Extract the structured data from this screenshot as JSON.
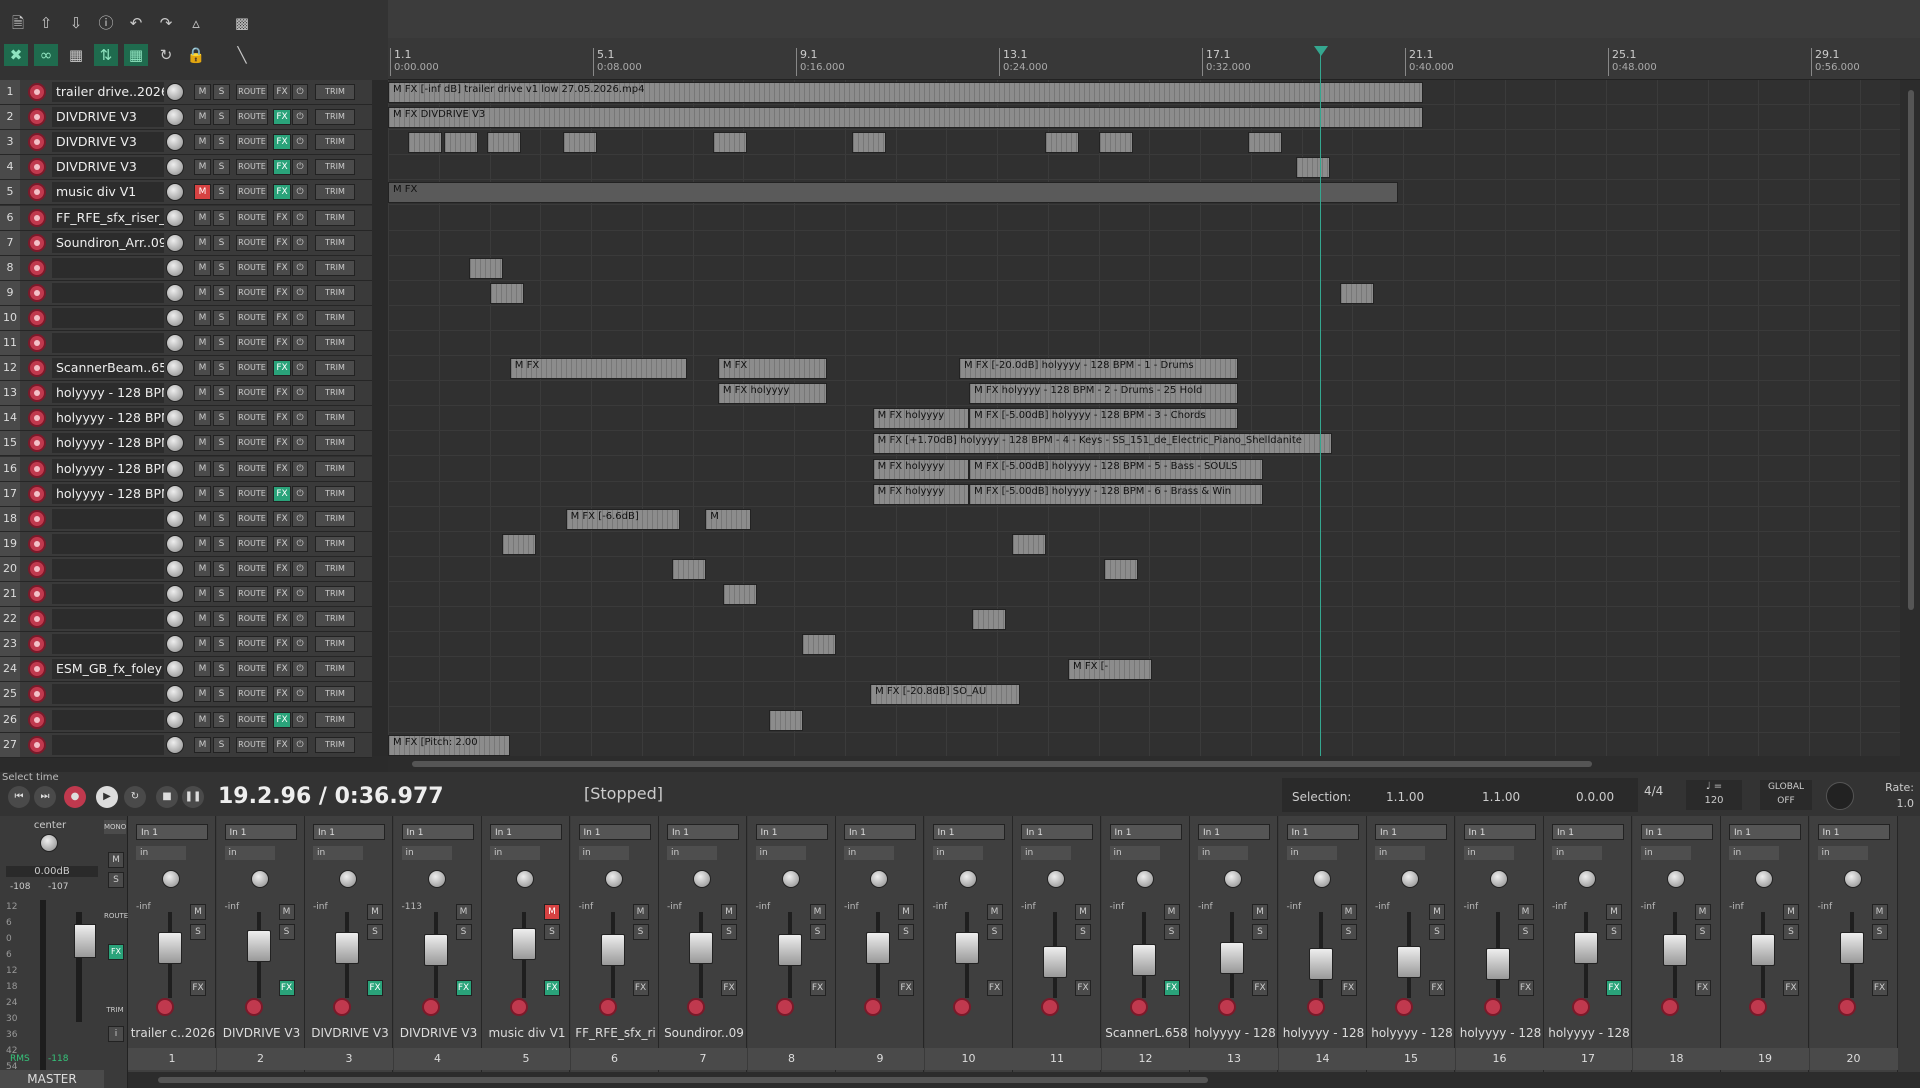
{
  "toolbar": {
    "row1": [
      "new-project",
      "open",
      "save",
      "info",
      "undo",
      "redo",
      "metronome",
      "grid-view"
    ],
    "row2": [
      "ripple",
      "link",
      "snap-grid",
      "move",
      "grid",
      "loop",
      "lock",
      "erase"
    ]
  },
  "ruler": {
    "markers": [
      {
        "bar": "1.1",
        "time": "0:00.000"
      },
      {
        "bar": "5.1",
        "time": "0:08.000"
      },
      {
        "bar": "9.1",
        "time": "0:16.000"
      },
      {
        "bar": "13.1",
        "time": "0:24.000"
      },
      {
        "bar": "17.1",
        "time": "0:32.000"
      },
      {
        "bar": "21.1",
        "time": "0:40.000"
      },
      {
        "bar": "25.1",
        "time": "0:48.000"
      },
      {
        "bar": "29.1",
        "time": "0:56.000"
      }
    ]
  },
  "tcp": {
    "mute": "M",
    "solo": "S",
    "route": "ROUTE",
    "fx": "FX",
    "trim": "TRIM",
    "tracks": [
      {
        "num": "1",
        "name": "trailer drive..2026",
        "fx_on": false,
        "muted": false
      },
      {
        "num": "2",
        "name": "DIVDRIVE V3",
        "fx_on": true,
        "muted": false
      },
      {
        "num": "3",
        "name": "DIVDRIVE V3",
        "fx_on": true,
        "muted": false
      },
      {
        "num": "4",
        "name": "DIVDRIVE V3",
        "fx_on": true,
        "muted": false
      },
      {
        "num": "5",
        "name": "music div  V1",
        "fx_on": true,
        "muted": true
      },
      {
        "num": "6",
        "name": "FF_RFE_sfx_riser_",
        "fx_on": false,
        "muted": false
      },
      {
        "num": "7",
        "name": "Soundiron_Arr..09",
        "fx_on": false,
        "muted": false
      },
      {
        "num": "8",
        "name": "",
        "fx_on": false,
        "muted": false
      },
      {
        "num": "9",
        "name": "",
        "fx_on": false,
        "muted": false
      },
      {
        "num": "10",
        "name": "",
        "fx_on": false,
        "muted": false
      },
      {
        "num": "11",
        "name": "",
        "fx_on": false,
        "muted": false
      },
      {
        "num": "12",
        "name": "ScannerBeam..658",
        "fx_on": true,
        "muted": false
      },
      {
        "num": "13",
        "name": "holyyyy - 128 BPM",
        "fx_on": false,
        "muted": false
      },
      {
        "num": "14",
        "name": "holyyyy - 128 BPM",
        "fx_on": false,
        "muted": false
      },
      {
        "num": "15",
        "name": "holyyyy - 128 BPM",
        "fx_on": false,
        "muted": false
      },
      {
        "num": "16",
        "name": "holyyyy - 128 BPM",
        "fx_on": false,
        "muted": false
      },
      {
        "num": "17",
        "name": "holyyyy - 128 BPM",
        "fx_on": true,
        "muted": false
      },
      {
        "num": "18",
        "name": "",
        "fx_on": false,
        "muted": false
      },
      {
        "num": "19",
        "name": "",
        "fx_on": false,
        "muted": false
      },
      {
        "num": "20",
        "name": "",
        "fx_on": false,
        "muted": false
      },
      {
        "num": "21",
        "name": "",
        "fx_on": false,
        "muted": false
      },
      {
        "num": "22",
        "name": "",
        "fx_on": false,
        "muted": false
      },
      {
        "num": "23",
        "name": "",
        "fx_on": false,
        "muted": false
      },
      {
        "num": "24",
        "name": "ESM_GB_fx_foley",
        "fx_on": false,
        "muted": false
      },
      {
        "num": "25",
        "name": "",
        "fx_on": false,
        "muted": false
      },
      {
        "num": "26",
        "name": "",
        "fx_on": true,
        "muted": false
      },
      {
        "num": "27",
        "name": "",
        "fx_on": false,
        "muted": false
      }
    ]
  },
  "items": [
    {
      "track": 1,
      "start_sec": 0.0,
      "end_sec": 40.8,
      "label": "M  FX  [-inf dB] trailer drive v1 low 27.05.2026.mp4"
    },
    {
      "track": 2,
      "start_sec": 0.0,
      "end_sec": 40.8,
      "label": "M    FX  DIVDRIVE V3"
    },
    {
      "track": 5,
      "start_sec": 0.0,
      "end_sec": 39.8,
      "label": "M FX"
    },
    {
      "track": 12,
      "start_sec": 4.8,
      "end_sec": 11.8,
      "label": "M FX"
    },
    {
      "track": 12,
      "start_sec": 13.0,
      "end_sec": 17.3,
      "label": "M FX"
    },
    {
      "track": 12,
      "start_sec": 22.5,
      "end_sec": 33.5,
      "label": "M FX [-20.0dB] holyyyy - 128 BPM - 1 - Drums"
    },
    {
      "track": 13,
      "start_sec": 13.0,
      "end_sec": 17.3,
      "label": "M FX holyyyy"
    },
    {
      "track": 13,
      "start_sec": 22.9,
      "end_sec": 33.5,
      "label": "M FX holyyyy - 128 BPM - 2 - Drums - 25 Hold"
    },
    {
      "track": 14,
      "start_sec": 19.1,
      "end_sec": 22.9,
      "label": "M FX holyyyy"
    },
    {
      "track": 14,
      "start_sec": 22.9,
      "end_sec": 33.5,
      "label": "M FX [-5.00dB] holyyyy - 128 BPM - 3 - Chords"
    },
    {
      "track": 15,
      "start_sec": 19.1,
      "end_sec": 37.2,
      "label": "M FX [+1.70dB] holyyyy - 128 BPM - 4 - Keys - SS_151_de_Electric_Piano_Shelldanite"
    },
    {
      "track": 16,
      "start_sec": 19.1,
      "end_sec": 22.9,
      "label": "M FX holyyyy"
    },
    {
      "track": 16,
      "start_sec": 22.9,
      "end_sec": 34.5,
      "label": "M FX [-5.00dB] holyyyy - 128 BPM - 5 - Bass - SOULS"
    },
    {
      "track": 17,
      "start_sec": 19.1,
      "end_sec": 22.9,
      "label": "M FX holyyyy"
    },
    {
      "track": 17,
      "start_sec": 22.9,
      "end_sec": 34.5,
      "label": "M FX [-5.00dB] holyyyy - 128 BPM - 6 - Brass & Win"
    },
    {
      "track": 18,
      "start_sec": 7.0,
      "end_sec": 11.5,
      "label": "M FX [-6.6dB]"
    },
    {
      "track": 18,
      "start_sec": 12.5,
      "end_sec": 14.3,
      "label": "M"
    },
    {
      "track": 24,
      "start_sec": 26.8,
      "end_sec": 30.1,
      "label": "M  FX [-"
    },
    {
      "track": 25,
      "start_sec": 19.0,
      "end_sec": 24.9,
      "label": "M FX [-20.8dB] SO_AU"
    },
    {
      "track": 27,
      "start_sec": 0.0,
      "end_sec": 4.8,
      "label": "M FX [Pitch: 2.00"
    }
  ],
  "small_items": [
    {
      "track": 3,
      "sec": 0.8
    },
    {
      "track": 3,
      "sec": 2.2
    },
    {
      "track": 3,
      "sec": 3.9
    },
    {
      "track": 3,
      "sec": 6.9
    },
    {
      "track": 3,
      "sec": 12.8
    },
    {
      "track": 3,
      "sec": 18.3
    },
    {
      "track": 3,
      "sec": 25.9
    },
    {
      "track": 3,
      "sec": 28.0
    },
    {
      "track": 3,
      "sec": 33.9
    },
    {
      "track": 4,
      "sec": 35.8
    },
    {
      "track": 8,
      "sec": 3.2
    },
    {
      "track": 9,
      "sec": 4.0
    },
    {
      "track": 9,
      "sec": 37.5
    },
    {
      "track": 19,
      "sec": 4.5
    },
    {
      "track": 19,
      "sec": 24.6
    },
    {
      "track": 20,
      "sec": 11.2
    },
    {
      "track": 20,
      "sec": 28.2
    },
    {
      "track": 21,
      "sec": 13.2
    },
    {
      "track": 22,
      "sec": 23.0
    },
    {
      "track": 23,
      "sec": 16.3
    },
    {
      "track": 26,
      "sec": 15.0
    }
  ],
  "transport": {
    "status_text": "Select time",
    "time": "19.2.96 / 0:36.977",
    "state": "[Stopped]",
    "selection_label": "Selection:",
    "sel_start": "1.1.00",
    "sel_end": "1.1.00",
    "sel_len": "0.0.00",
    "time_sig": "4/4",
    "tempo": "120",
    "global_label": "GLOBAL",
    "global_value": "OFF",
    "rate_label": "Rate:",
    "rate_value": "1.0"
  },
  "master": {
    "pan": "center",
    "db": "0.00dB",
    "peak_l": "-108",
    "peak_r": "-107",
    "rms": "RMS",
    "rms_value": "-118",
    "mono": "MONO",
    "route": "ROUTE",
    "trim": "TRIM",
    "label": "MASTER",
    "scale": [
      "12",
      "6",
      "0",
      "6",
      "12",
      "18",
      "24",
      "30",
      "36",
      "42",
      "54"
    ]
  },
  "mixer": {
    "input": "In 1",
    "in_small": "in",
    "strips": [
      {
        "num": "1",
        "name": "trailer c..2026",
        "vol": "-inf",
        "muted": false,
        "fx_on": false
      },
      {
        "num": "2",
        "name": "DIVDRIVE V3",
        "vol": "-inf",
        "muted": false,
        "fx_on": true
      },
      {
        "num": "3",
        "name": "DIVDRIVE V3",
        "vol": "-inf",
        "muted": false,
        "fx_on": true
      },
      {
        "num": "4",
        "name": "DIVDRIVE V3",
        "vol": "-113",
        "muted": false,
        "fx_on": true
      },
      {
        "num": "5",
        "name": "music div  V1",
        "vol": "",
        "muted": true,
        "fx_on": true
      },
      {
        "num": "6",
        "name": "FF_RFE_sfx_ri",
        "vol": "-inf",
        "muted": false,
        "fx_on": false
      },
      {
        "num": "7",
        "name": "Soundiror..09",
        "vol": "-inf",
        "muted": false,
        "fx_on": false
      },
      {
        "num": "8",
        "name": "",
        "vol": "-inf",
        "muted": false,
        "fx_on": false
      },
      {
        "num": "9",
        "name": "",
        "vol": "-inf",
        "muted": false,
        "fx_on": false
      },
      {
        "num": "10",
        "name": "",
        "vol": "-inf",
        "muted": false,
        "fx_on": false
      },
      {
        "num": "11",
        "name": "",
        "vol": "-inf",
        "muted": false,
        "fx_on": false
      },
      {
        "num": "12",
        "name": "ScannerL.658",
        "vol": "-inf",
        "muted": false,
        "fx_on": true
      },
      {
        "num": "13",
        "name": "holyyyy - 128",
        "vol": "-inf",
        "muted": false,
        "fx_on": false
      },
      {
        "num": "14",
        "name": "holyyyy - 128",
        "vol": "-inf",
        "muted": false,
        "fx_on": false
      },
      {
        "num": "15",
        "name": "holyyyy - 128",
        "vol": "-inf",
        "muted": false,
        "fx_on": false
      },
      {
        "num": "16",
        "name": "holyyyy - 128",
        "vol": "-inf",
        "muted": false,
        "fx_on": false
      },
      {
        "num": "17",
        "name": "holyyyy - 128",
        "vol": "-inf",
        "muted": false,
        "fx_on": true
      },
      {
        "num": "18",
        "name": "",
        "vol": "-inf",
        "muted": false,
        "fx_on": false
      },
      {
        "num": "19",
        "name": "",
        "vol": "-inf",
        "muted": false,
        "fx_on": false
      },
      {
        "num": "20",
        "name": "",
        "vol": "-inf",
        "muted": false,
        "fx_on": false
      }
    ]
  },
  "colors": {
    "accent": "#35a790",
    "mute": "#d64242",
    "fx_on": "#2aa37a",
    "record": "#c0394e"
  }
}
